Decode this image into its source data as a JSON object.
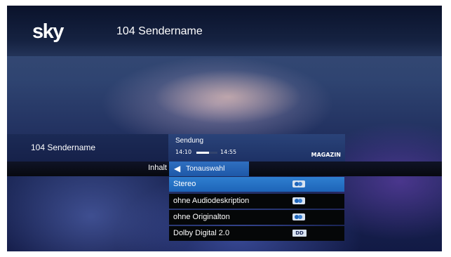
{
  "header": {
    "logo": "sky",
    "channel": "104 Sendername"
  },
  "info_bar": {
    "channel": "104 Sendername",
    "show": "Sendung",
    "time_start": "14:10",
    "time_end": "14:55",
    "progress": 0.6,
    "genre": "MAGAZIN"
  },
  "menu": {
    "category": "Inhalt",
    "section": "Tonauswahl",
    "back_icon": "left-triangle-icon"
  },
  "audio_options": [
    {
      "label": "Stereo",
      "icon": "stereo-icon",
      "selected": true
    },
    {
      "label": "ohne Audiodeskription",
      "icon": "stereo-icon",
      "selected": false
    },
    {
      "label": "ohne Originalton",
      "icon": "stereo-icon",
      "selected": false
    },
    {
      "label": "Dolby Digital 2.0",
      "icon": "dolby-digital-icon",
      "icon_text": "DD",
      "selected": false
    }
  ],
  "colors": {
    "selection_blue": "#1d64b8",
    "panel_dark": "#050708",
    "info_blue": "#2a4379"
  }
}
